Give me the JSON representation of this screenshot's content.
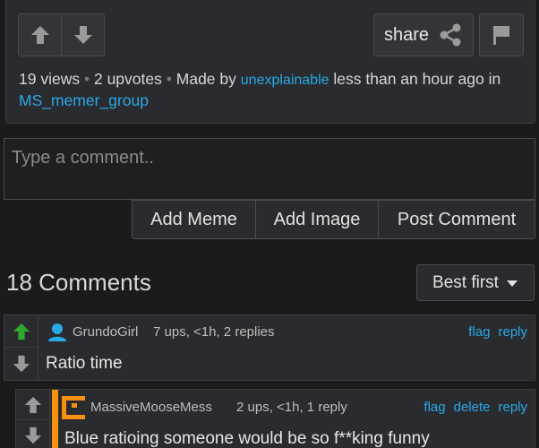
{
  "post": {
    "share_label": "share",
    "views": "19 views",
    "upvotes": "2 upvotes",
    "made_by_prefix": "Made by",
    "author": "unexplainable",
    "time": "less than an hour ago in",
    "stream": "MS_memer_group"
  },
  "compose": {
    "placeholder": "Type a comment..",
    "add_meme": "Add Meme",
    "add_image": "Add Image",
    "post_comment": "Post Comment"
  },
  "comments_header": {
    "count_label": "18 Comments",
    "sort_label": "Best first"
  },
  "comments": [
    {
      "user": "GrundoGirl",
      "stats": "7 ups, <1h, 2 replies",
      "actions": [
        "flag",
        "reply"
      ],
      "text": "Ratio time"
    },
    {
      "user": "MassiveMooseMess",
      "stats": "2 ups, <1h, 1 reply",
      "actions": [
        "flag",
        "delete",
        "reply"
      ],
      "text": "Blue ratioing someone would be so f**king funny"
    }
  ],
  "colors": {
    "upvoted": "#2ea82e",
    "link": "#29a9e8",
    "avatar_blue": "#29a9e8",
    "avatar_orange": "#f5910f"
  },
  "icons": [
    "arrow-up-icon",
    "arrow-down-icon",
    "share-icon",
    "flag-icon",
    "caret-down-icon",
    "user-avatar-icon",
    "custom-avatar-icon"
  ]
}
